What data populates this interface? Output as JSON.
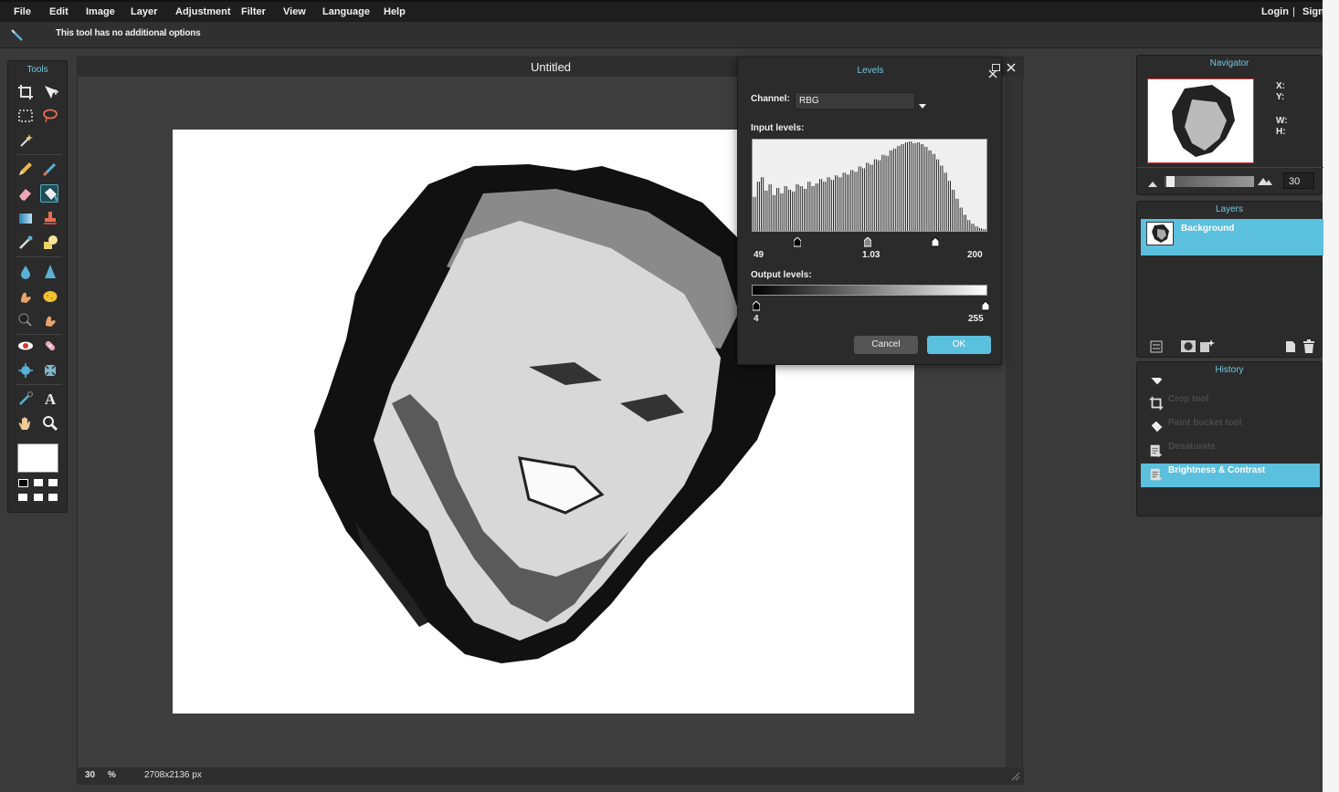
{
  "menu": {
    "items": [
      "File",
      "Edit",
      "Image",
      "Layer",
      "Adjustment",
      "Filter",
      "View",
      "Language",
      "Help"
    ],
    "login": "Login",
    "divider": "|",
    "signup": "Sign"
  },
  "options_bar": {
    "message": "This tool has no additional options"
  },
  "tools_panel": {
    "title": "Tools",
    "tools": [
      "crop-icon",
      "move-icon",
      "marquee-icon",
      "lasso-icon",
      "magic-wand-icon",
      "pencil-icon",
      "brush-icon",
      "eraser-icon",
      "paint-bucket-icon",
      "gradient-icon",
      "clone-stamp-icon",
      "color-replace-icon",
      "drawing-icon",
      "blur-icon",
      "sharpen-icon",
      "smudge-icon",
      "sponge-icon",
      "dodge-icon",
      "burn-icon",
      "red-eye-icon",
      "spot-heal-icon",
      "bloat-icon",
      "pinch-icon",
      "color-picker-icon",
      "type-icon",
      "hand-icon",
      "zoom-icon"
    ],
    "active_tool": "paint-bucket-icon",
    "foreground_color": "#ffffff"
  },
  "document": {
    "title": "Untitled",
    "zoom": "30",
    "zoom_unit": "%",
    "dimensions": "2708x2136 px"
  },
  "levels_dialog": {
    "title": "Levels",
    "channel_label": "Channel:",
    "channel_value": "RBG",
    "input_label": "Input levels:",
    "input_black": "49",
    "input_gamma": "1.03",
    "input_white": "200",
    "output_label": "Output levels:",
    "output_black": "4",
    "output_white": "255",
    "cancel_label": "Cancel",
    "ok_label": "OK",
    "ok_color": "#5bc0de",
    "histogram": [
      0.38,
      0.55,
      0.6,
      0.45,
      0.52,
      0.4,
      0.48,
      0.42,
      0.5,
      0.46,
      0.44,
      0.52,
      0.5,
      0.47,
      0.55,
      0.5,
      0.53,
      0.58,
      0.55,
      0.6,
      0.57,
      0.62,
      0.6,
      0.65,
      0.63,
      0.68,
      0.66,
      0.72,
      0.7,
      0.76,
      0.74,
      0.8,
      0.79,
      0.85,
      0.84,
      0.9,
      0.92,
      0.95,
      0.97,
      0.99,
      1.0,
      0.98,
      0.99,
      0.97,
      0.94,
      0.9,
      0.86,
      0.8,
      0.73,
      0.65,
      0.56,
      0.46,
      0.36,
      0.26,
      0.18,
      0.12,
      0.08,
      0.05,
      0.03,
      0.02
    ]
  },
  "navigator": {
    "title": "Navigator",
    "x_label": "X:",
    "y_label": "Y:",
    "w_label": "W:",
    "h_label": "H:",
    "zoom_value": "30"
  },
  "layers": {
    "title": "Layers",
    "items": [
      {
        "name": "Background"
      }
    ]
  },
  "history": {
    "title": "History",
    "items": [
      {
        "label": "Paint bucket tool",
        "icon": "paint-bucket-icon"
      },
      {
        "label": "Crop tool",
        "icon": "crop-icon"
      },
      {
        "label": "Paint bucket tool",
        "icon": "paint-bucket-icon"
      },
      {
        "label": "Desaturate",
        "icon": "adjustment-icon"
      },
      {
        "label": "Brightness & Contrast",
        "icon": "adjustment-icon"
      }
    ],
    "active_index": 4
  }
}
